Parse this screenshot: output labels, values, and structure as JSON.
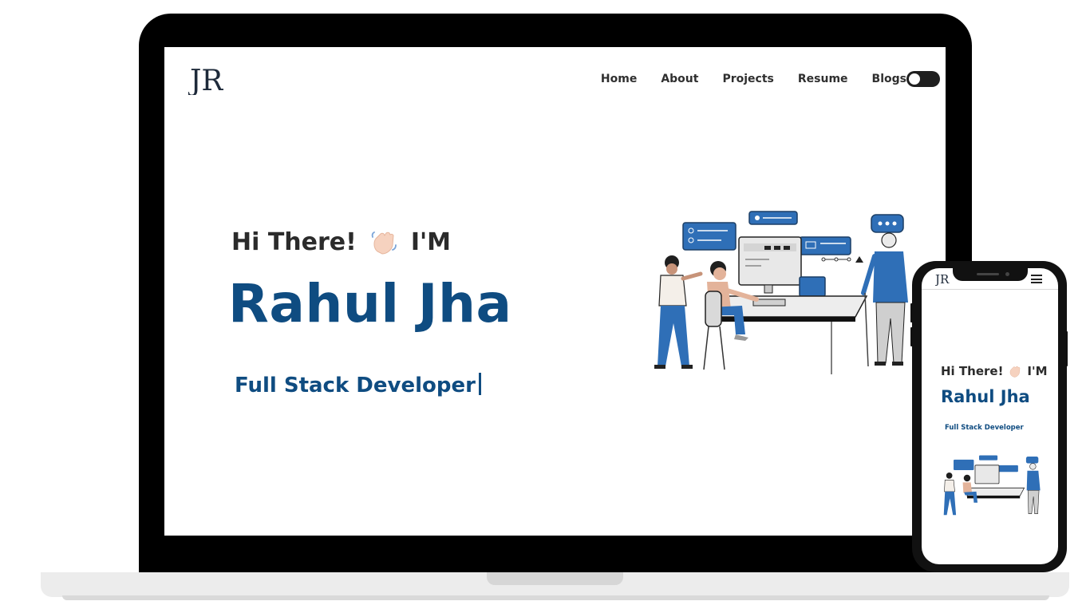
{
  "site": {
    "logo_text": "JR",
    "nav": {
      "items": [
        "Home",
        "About",
        "Projects",
        "Resume",
        "Blogs"
      ]
    },
    "theme_toggle": {
      "state": "off"
    }
  },
  "hero": {
    "greeting": "Hi There!",
    "wave_icon": "waving-hand",
    "im": "I'M",
    "name": "Rahul Jha",
    "role": "Full Stack Developer"
  },
  "mobile": {
    "greeting": "Hi There!",
    "im": "I'M",
    "name": "Rahul Jha",
    "role": "Full Stack Developer",
    "menu_icon": "hamburger-menu"
  },
  "colors": {
    "accent": "#0f4c81",
    "illustration_blue": "#2f6fb7",
    "text_dark": "#2b2b2b",
    "device_frame": "#000000"
  }
}
